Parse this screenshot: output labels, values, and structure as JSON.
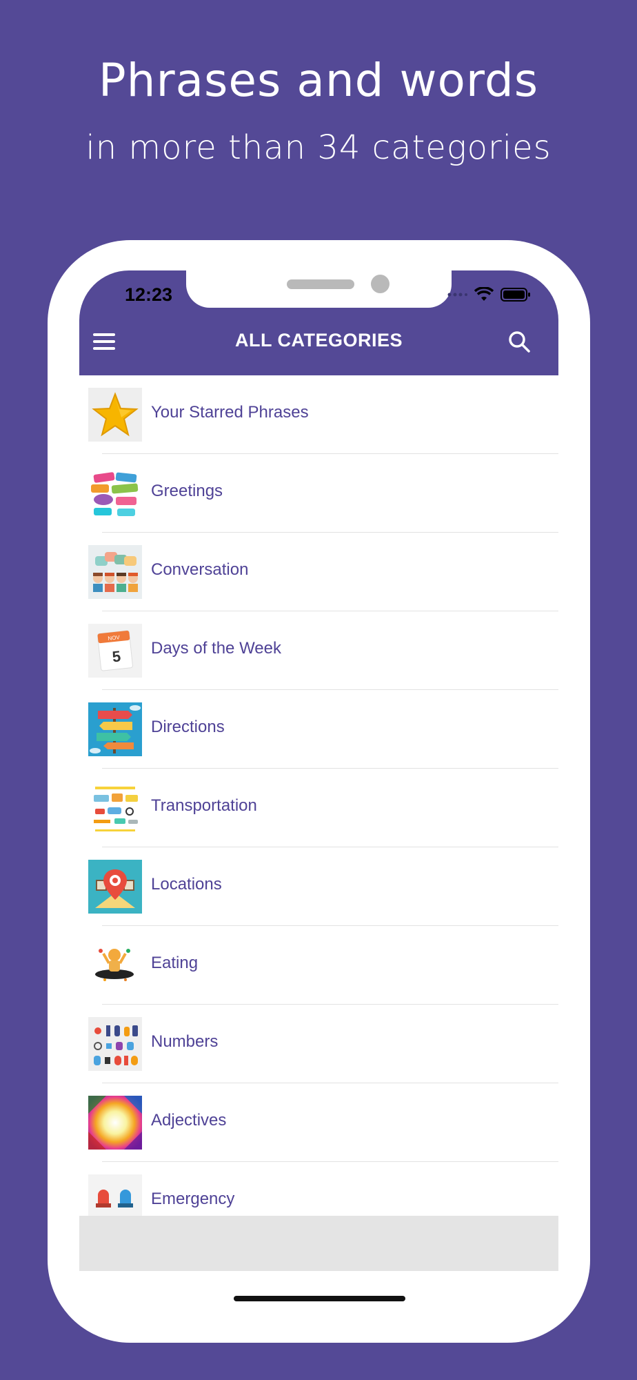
{
  "promo": {
    "headline": "Phrases and words",
    "subline": "in more than 34 categories"
  },
  "status_bar": {
    "time": "12:23"
  },
  "header": {
    "title": "ALL CATEGORIES",
    "menu_icon": "hamburger-menu-icon",
    "search_icon": "search-icon"
  },
  "categories": [
    {
      "label": "Your Starred Phrases",
      "icon": "star-icon"
    },
    {
      "label": "Greetings",
      "icon": "greetings-image"
    },
    {
      "label": "Conversation",
      "icon": "conversation-image"
    },
    {
      "label": "Days of the Week",
      "icon": "calendar-image"
    },
    {
      "label": "Directions",
      "icon": "directions-image"
    },
    {
      "label": "Transportation",
      "icon": "transportation-image"
    },
    {
      "label": "Locations",
      "icon": "locations-image"
    },
    {
      "label": "Eating",
      "icon": "eating-image"
    },
    {
      "label": "Numbers",
      "icon": "numbers-image"
    },
    {
      "label": "Adjectives",
      "icon": "adjectives-image"
    },
    {
      "label": "Emergency",
      "icon": "emergency-image"
    }
  ],
  "calendar_thumb": {
    "month": "NOV",
    "day": "5"
  },
  "colors": {
    "brand": "#544996",
    "label": "#4f4296"
  }
}
